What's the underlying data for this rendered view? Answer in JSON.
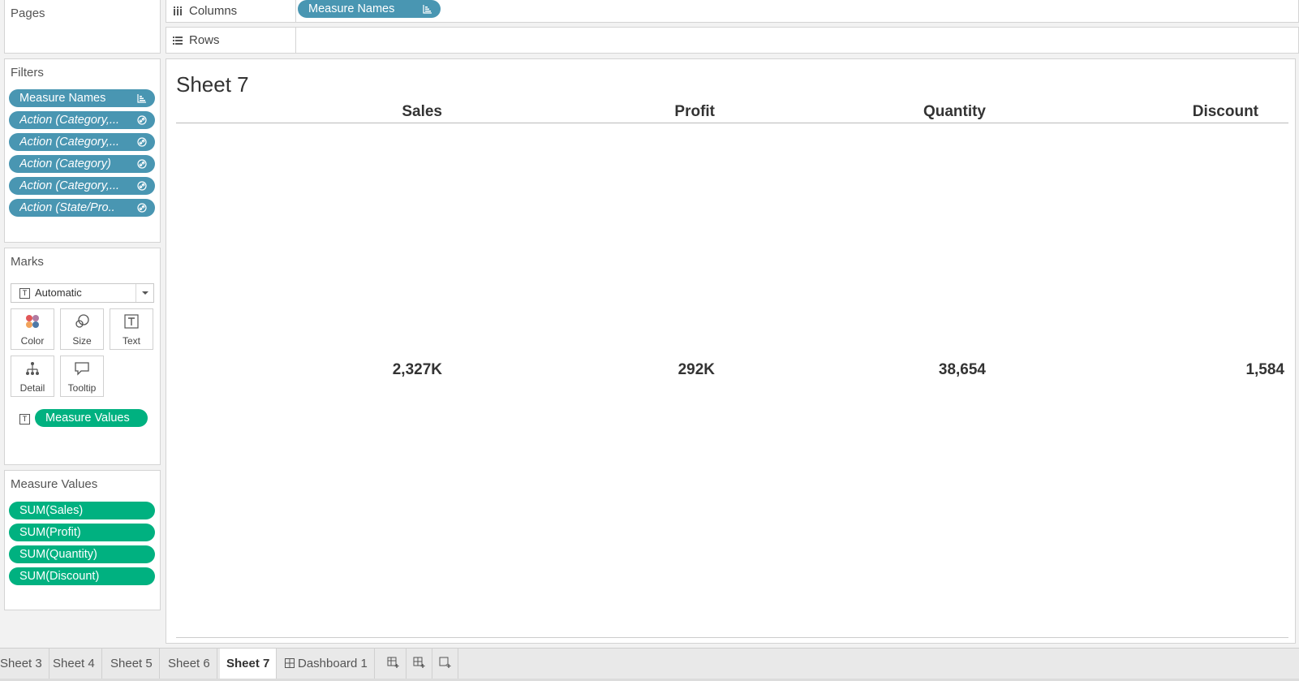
{
  "pages": {
    "title": "Pages"
  },
  "filters": {
    "title": "Filters",
    "items": [
      {
        "label": "Measure Names",
        "italic": false
      },
      {
        "label": "Action (Category,...",
        "italic": true
      },
      {
        "label": "Action (Category,...",
        "italic": true
      },
      {
        "label": "Action (Category)",
        "italic": true
      },
      {
        "label": "Action (Category,...",
        "italic": true
      },
      {
        "label": "Action (State/Pro..",
        "italic": true
      }
    ]
  },
  "marks": {
    "title": "Marks",
    "type": "Automatic",
    "buttons": {
      "color": "Color",
      "size": "Size",
      "text": "Text",
      "detail": "Detail",
      "tooltip": "Tooltip"
    },
    "text_pill": "Measure Values"
  },
  "measure_values": {
    "title": "Measure Values",
    "items": [
      "SUM(Sales)",
      "SUM(Profit)",
      "SUM(Quantity)",
      "SUM(Discount)"
    ]
  },
  "shelves": {
    "columns_label": "Columns",
    "columns_pill": "Measure Names",
    "rows_label": "Rows"
  },
  "sheet": {
    "title": "Sheet 7",
    "headers": [
      "Sales",
      "Profit",
      "Quantity",
      "Discount"
    ],
    "values": [
      "2,327K",
      "292K",
      "38,654",
      "1,584"
    ]
  },
  "tabs": [
    "Sheet 3",
    "Sheet 4",
    "Sheet 5",
    "Sheet 6",
    "Sheet 7",
    "Dashboard 1"
  ],
  "active_tab": "Sheet 7",
  "colors": {
    "dimension_pill": "#4996b2",
    "measure_pill": "#00b180"
  }
}
